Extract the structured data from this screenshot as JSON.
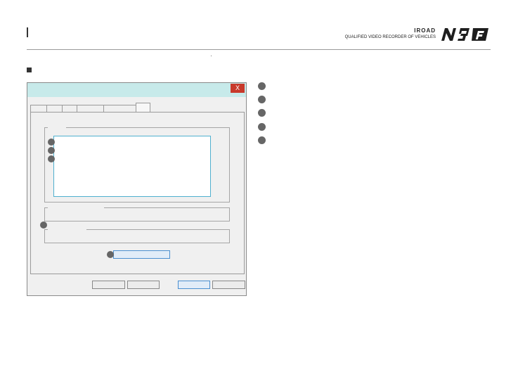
{
  "header": {
    "brand_name": "IROAD",
    "brand_tagline": "QUALIFIED VIDEO RECORDER OF VEHICLES",
    "model_logo": "N9F"
  },
  "dialog": {
    "close_label": "X"
  },
  "colors": {
    "titlebar": "#c7eaea",
    "close_button": "#c8392b",
    "listbox_border": "#4fb0cf",
    "primary_button_border": "#4a8fd0",
    "badge": "#666666"
  }
}
